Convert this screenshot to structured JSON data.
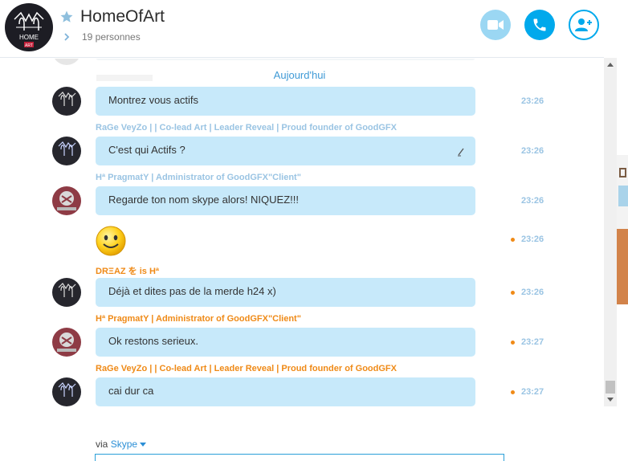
{
  "header": {
    "title": "HomeOfArt",
    "participants": "19 personnes",
    "avatar_text": "HOME ART"
  },
  "messages": {
    "date_divider": "Aujourd'hui",
    "items": [
      {
        "sender": "",
        "sender_color": "blue",
        "text": "Montrez vous actifs",
        "time": "23:26",
        "unread": false,
        "edited": false
      },
      {
        "sender": "RaGe VeyZo | | Co-lead Art | Leader Reveal | Proud founder of GoodGFX",
        "sender_color": "blue",
        "text": "C'est qui Actifs ?",
        "time": "23:26",
        "unread": false,
        "edited": true
      },
      {
        "sender": "Hª PragmatY | Administrator of GoodGFX\"Client\"",
        "sender_color": "blue",
        "text": "Regarde ton nom skype alors! NIQUEZ!!!",
        "time": "23:26",
        "unread": false,
        "edited": false
      },
      {
        "sender": "",
        "sender_color": "blue",
        "text": "",
        "emoji": "smiley",
        "time": "23:26",
        "unread": true,
        "edited": false
      },
      {
        "sender": "DRΞAZ を is Hª",
        "sender_color": "orange",
        "text": "Déjà et dites pas de la merde h24 x)",
        "time": "23:26",
        "unread": true,
        "edited": false
      },
      {
        "sender": "Hª PragmatY | Administrator of GoodGFX\"Client\"",
        "sender_color": "orange",
        "text": "Ok restons serieux.",
        "time": "23:27",
        "unread": true,
        "edited": false
      },
      {
        "sender": "RaGe VeyZo | | Co-lead Art | Leader Reveal | Proud founder of GoodGFX",
        "sender_color": "orange",
        "text": "cai dur ca",
        "time": "23:27",
        "unread": true,
        "edited": false
      }
    ]
  },
  "footer": {
    "via_label": "via",
    "via_service": "Skype"
  },
  "colors": {
    "accent": "#00a9ec",
    "bubble": "#c7e9fa",
    "unread": "#ef8a17",
    "read_meta": "#9ac4e3"
  },
  "icons": [
    "star-icon",
    "chevron-right-icon",
    "video-camera-icon",
    "phone-icon",
    "add-person-icon",
    "pencil-icon",
    "smiley-emoticon",
    "caret-down-icon"
  ]
}
